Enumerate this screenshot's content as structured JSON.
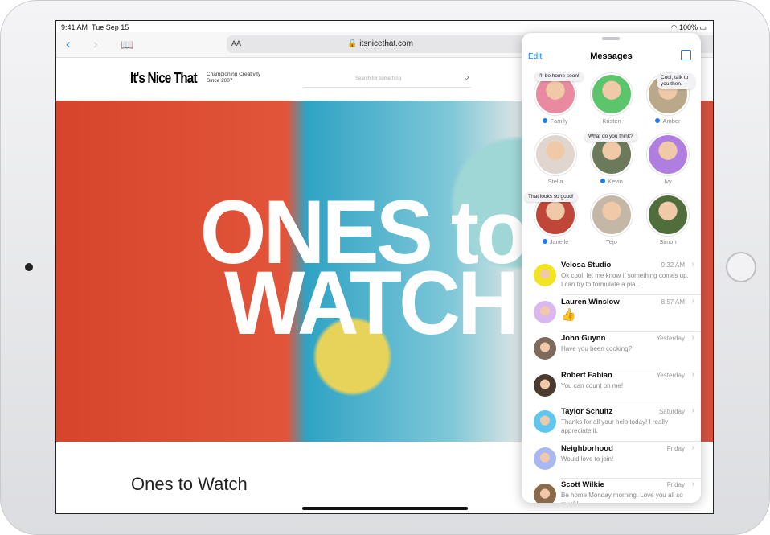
{
  "status": {
    "time": "9:41 AM",
    "date": "Tue Sep 15",
    "battery": "100%"
  },
  "safari": {
    "text_size": "AA",
    "url": "itsnicethat.com"
  },
  "site": {
    "logo": "It's Nice That",
    "tagline_1": "Championing Creativity",
    "tagline_2": "Since 2007",
    "search_placeholder": "Search for something",
    "hero_line1": "ONES to",
    "hero_line2": "WATCH",
    "article_title": "Ones to Watch"
  },
  "messages": {
    "edit": "Edit",
    "title": "Messages",
    "pins": [
      {
        "name": "Family",
        "unread": true,
        "bubble": "I'll be home soon!",
        "color": "#e98aa0"
      },
      {
        "name": "Kristen",
        "unread": false,
        "bubble": "",
        "color": "#5cc46a"
      },
      {
        "name": "Amber",
        "unread": true,
        "bubble": "Cool, talk to you then.",
        "color": "#b9a98a"
      },
      {
        "name": "Stella",
        "unread": false,
        "bubble": "",
        "color": "#e0d6cf"
      },
      {
        "name": "Kevin",
        "unread": true,
        "bubble": "What do you think?",
        "color": "#6c7a5c"
      },
      {
        "name": "Ivy",
        "unread": false,
        "bubble": "",
        "color": "#b07ee0"
      },
      {
        "name": "Janelle",
        "unread": true,
        "bubble": "That looks so good!",
        "color": "#c0463a"
      },
      {
        "name": "Tejo",
        "unread": false,
        "bubble": "",
        "color": "#c5b7a5"
      },
      {
        "name": "Simon",
        "unread": false,
        "bubble": "",
        "color": "#4f6e3b"
      }
    ],
    "conversations": [
      {
        "name": "Velosa Studio",
        "time": "9:32 AM",
        "preview": "Ok cool, let me know if something comes up. I can try to formulate a pla...",
        "color": "#f2e421"
      },
      {
        "name": "Lauren Winslow",
        "time": "8:57 AM",
        "preview": "👍",
        "color": "#d9b8ef"
      },
      {
        "name": "John Guynn",
        "time": "Yesterday",
        "preview": "Have you been cooking?",
        "color": "#7d6a5c"
      },
      {
        "name": "Robert Fabian",
        "time": "Yesterday",
        "preview": "You can count on me!",
        "color": "#4a3a30"
      },
      {
        "name": "Taylor Schultz",
        "time": "Saturday",
        "preview": "Thanks for all your help today! I really appreciate it.",
        "color": "#5ec6ef"
      },
      {
        "name": "Neighborhood",
        "time": "Friday",
        "preview": "Would love to join!",
        "color": "#a9b8f2"
      },
      {
        "name": "Scott Wilkie",
        "time": "Friday",
        "preview": "Be home Monday morning. Love you all so much!",
        "color": "#8a6a4a"
      }
    ]
  }
}
